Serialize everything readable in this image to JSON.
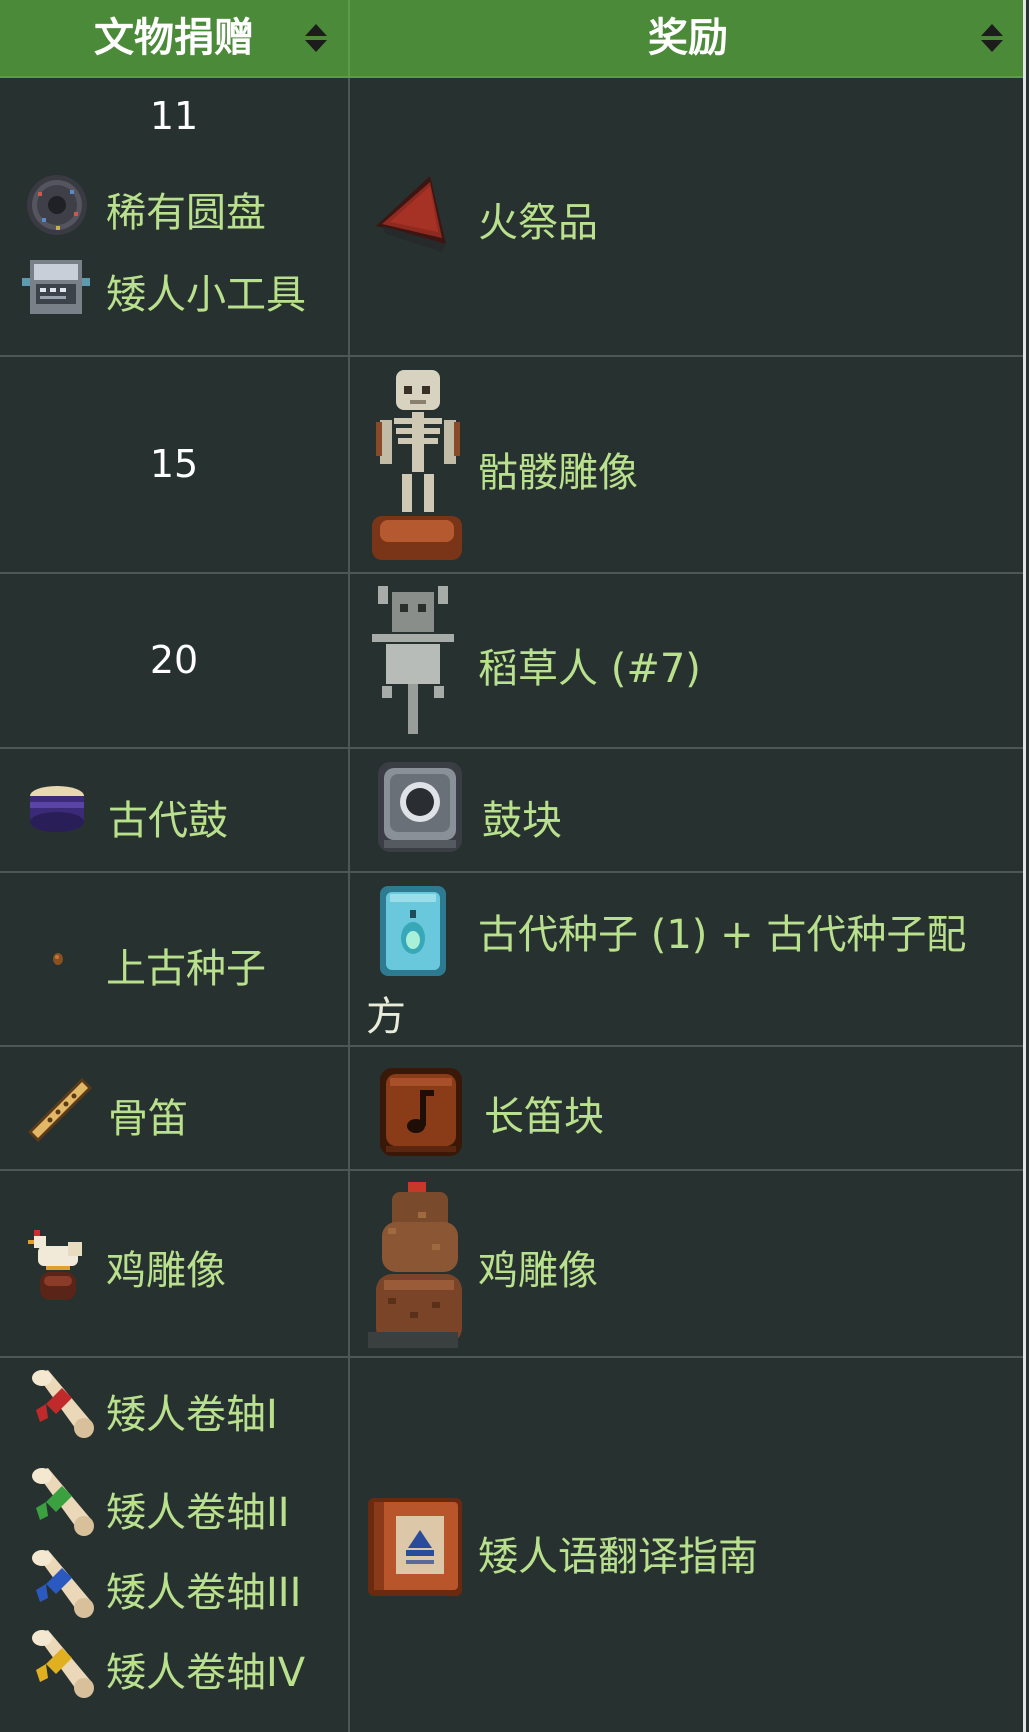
{
  "header": {
    "col1": "文物捐赠",
    "col2": "奖励"
  },
  "rows": [
    {
      "count": "11",
      "donations": [
        {
          "icon": "rare-disc-icon",
          "label": "稀有圆盘"
        },
        {
          "icon": "dwarf-gadget-icon",
          "label": "矮人小工具"
        }
      ],
      "reward": {
        "icon": "fire-offering-icon",
        "label": "火祭品"
      }
    },
    {
      "count": "15",
      "reward": {
        "icon": "skeleton-statue-icon",
        "label": "骷髅雕像"
      }
    },
    {
      "count": "20",
      "reward": {
        "icon": "scarecrow-icon",
        "label": "稻草人 (#7)"
      }
    },
    {
      "donations": [
        {
          "icon": "ancient-drum-icon",
          "label": "古代鼓"
        }
      ],
      "reward": {
        "icon": "drum-block-icon",
        "label": "鼓块"
      }
    },
    {
      "donations": [
        {
          "icon": "ancient-seed-icon",
          "label": "上古种子"
        }
      ],
      "reward": {
        "icon": "ancient-seed-packet-icon",
        "label_line1": "古代种子 (1) + 古代种子配",
        "label_line2": "方"
      }
    },
    {
      "donations": [
        {
          "icon": "bone-flute-icon",
          "label": "骨笛"
        }
      ],
      "reward": {
        "icon": "flute-block-icon",
        "label": "长笛块"
      }
    },
    {
      "donations": [
        {
          "icon": "chicken-statue-icon",
          "label": "鸡雕像"
        }
      ],
      "reward": {
        "icon": "chicken-statue-large-icon",
        "label": "鸡雕像"
      }
    },
    {
      "donations": [
        {
          "icon": "dwarf-scroll-1-icon",
          "label": "矮人卷轴I"
        },
        {
          "icon": "dwarf-scroll-2-icon",
          "label": "矮人卷轴II"
        },
        {
          "icon": "dwarf-scroll-3-icon",
          "label": "矮人卷轴III"
        },
        {
          "icon": "dwarf-scroll-4-icon",
          "label": "矮人卷轴IV"
        }
      ],
      "reward": {
        "icon": "dwarvish-translation-guide-icon",
        "label": "矮人语翻译指南"
      }
    }
  ],
  "colors": {
    "header_bg": "#4a8a38",
    "table_bg": "#263130",
    "link_text": "#b9e08c",
    "plain_text": "#ffffff"
  }
}
